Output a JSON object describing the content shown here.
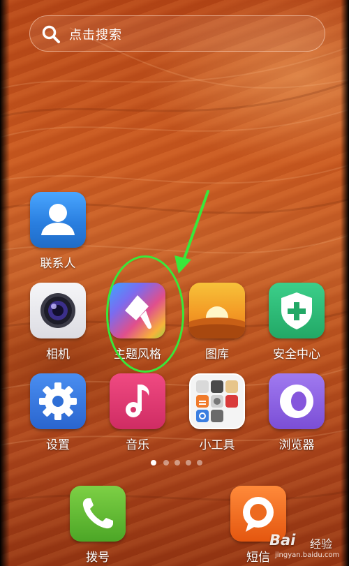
{
  "search": {
    "label": "点击搜索"
  },
  "apps": [
    {
      "id": "contacts",
      "label": "联系人",
      "icon": "contacts-icon",
      "color": "#2f86e6"
    },
    {
      "id": "camera",
      "label": "相机",
      "icon": "camera-icon",
      "color": "#e9e9ee"
    },
    {
      "id": "themes",
      "label": "主题风格",
      "icon": "paintbrush-icon",
      "color": "#7a6cf0"
    },
    {
      "id": "gallery",
      "label": "图库",
      "icon": "sunset-icon",
      "color": "#f2a22a"
    },
    {
      "id": "security",
      "label": "安全中心",
      "icon": "shield-plus-icon",
      "color": "#2bb673"
    },
    {
      "id": "settings",
      "label": "设置",
      "icon": "gear-icon",
      "color": "#2e6fd6"
    },
    {
      "id": "music",
      "label": "音乐",
      "icon": "music-note-icon",
      "color": "#e0336e"
    },
    {
      "id": "tools",
      "label": "小工具",
      "icon": "tools-folder-icon",
      "color": "#ffffff"
    },
    {
      "id": "browser",
      "label": "浏览器",
      "icon": "browser-ring-icon",
      "color": "#8b5ee0"
    }
  ],
  "dock": [
    {
      "id": "dialer",
      "label": "拨号",
      "icon": "phone-icon",
      "color": "#5cb82f"
    },
    {
      "id": "sms",
      "label": "短信",
      "icon": "message-bubble-icon",
      "color": "#f26b1d"
    }
  ],
  "pager": {
    "pages": 5,
    "current": 1
  },
  "annotation": {
    "highlight_color": "#39e83a"
  },
  "watermark": {
    "brand": "Bai",
    "product": "经验",
    "url": "jingyan.baidu.com"
  }
}
